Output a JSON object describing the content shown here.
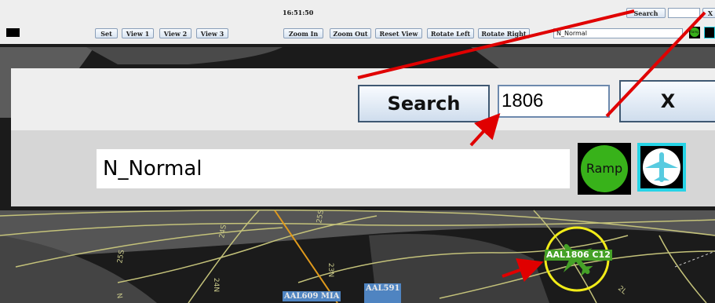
{
  "toolbar": {
    "time": "16:51:50",
    "search_label": "Search",
    "close_label": "X",
    "search_value": "",
    "buttons": [
      {
        "label": "Set"
      },
      {
        "label": "View 1"
      },
      {
        "label": "View 2"
      },
      {
        "label": "View 3"
      },
      {
        "label": "Zoom In"
      },
      {
        "label": "Zoom Out"
      },
      {
        "label": "Reset View"
      },
      {
        "label": "Rotate Left"
      },
      {
        "label": "Rotate Right"
      }
    ],
    "mode_value": "N_Normal",
    "ramp_label": "Ramp"
  },
  "zoom_panel": {
    "search_label": "Search",
    "search_value": "1806",
    "close_label": "X",
    "mode_value": "N_Normal",
    "ramp_label": "Ramp"
  },
  "map": {
    "flight_labels": [
      {
        "text": "AAL609 MIA"
      },
      {
        "text": "AAL591"
      }
    ],
    "highlighted_flight": "AAL1806 C12",
    "taxi_labels": [
      "25S",
      "24S",
      "25S",
      "23N",
      "24N",
      "2L",
      "N"
    ]
  },
  "colors": {
    "annotation": "#e00000",
    "highlight_ring": "#f2ec18",
    "ramp_green": "#38b21a",
    "plane_border": "#26d3e6"
  }
}
